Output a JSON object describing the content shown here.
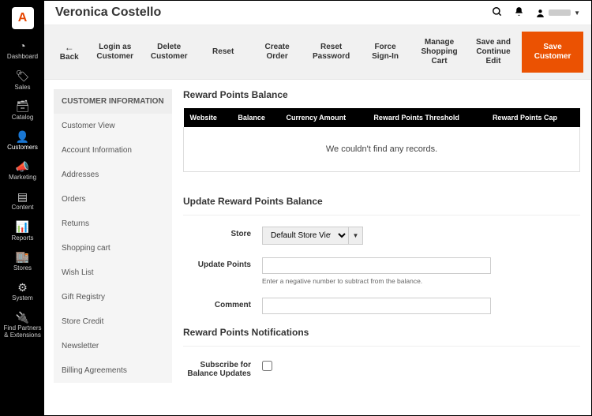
{
  "sidenav": {
    "logo": "A",
    "items": [
      {
        "label": "Dashboard",
        "icon": "◔"
      },
      {
        "label": "Sales",
        "icon": "🏷"
      },
      {
        "label": "Catalog",
        "icon": "🗃"
      },
      {
        "label": "Customers",
        "icon": "👤",
        "active": true
      },
      {
        "label": "Marketing",
        "icon": "📣"
      },
      {
        "label": "Content",
        "icon": "▤"
      },
      {
        "label": "Reports",
        "icon": "📊"
      },
      {
        "label": "Stores",
        "icon": "🏬"
      },
      {
        "label": "System",
        "icon": "⚙"
      },
      {
        "label": "Find Partners & Extensions",
        "icon": "🔌"
      }
    ]
  },
  "topbar": {
    "title": "Veronica Costello",
    "search_icon": "search-icon",
    "bell_icon": "bell-icon",
    "user_icon": "user-icon"
  },
  "actions": {
    "back": "Back",
    "login_as": "Login as Customer",
    "delete": "Delete Customer",
    "reset": "Reset",
    "create_order": "Create Order",
    "reset_password": "Reset Password",
    "force_signin": "Force Sign-In",
    "manage_cart": "Manage Shopping Cart",
    "save_continue": "Save and Continue Edit",
    "save_customer": "Save Customer"
  },
  "customer_info": {
    "heading": "CUSTOMER INFORMATION",
    "items": [
      "Customer View",
      "Account Information",
      "Addresses",
      "Orders",
      "Returns",
      "Shopping cart",
      "Wish List",
      "Gift Registry",
      "Store Credit",
      "Newsletter",
      "Billing Agreements"
    ]
  },
  "balance_section": {
    "title": "Reward Points Balance",
    "cols": [
      "Website",
      "Balance",
      "Currency Amount",
      "Reward Points Threshold",
      "Reward Points Cap"
    ],
    "empty": "We couldn't find any records."
  },
  "update_section": {
    "title": "Update Reward Points Balance",
    "store_label": "Store",
    "store_value": "Default Store View",
    "points_label": "Update Points",
    "points_hint": "Enter a negative number to subtract from the balance.",
    "comment_label": "Comment"
  },
  "notify_section": {
    "title": "Reward Points Notifications",
    "subscribe_label": "Subscribe for Balance Updates"
  }
}
